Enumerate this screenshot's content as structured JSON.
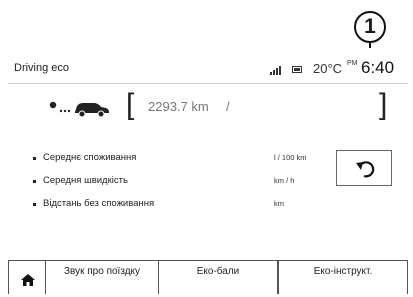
{
  "callout": {
    "number": "1"
  },
  "header": {
    "title": "Driving eco",
    "temperature": "20°C",
    "ampm": "PM",
    "time": "6:40"
  },
  "summary": {
    "car_icon": "trip-car-icon",
    "distance": "2293.7 km",
    "separator": "/"
  },
  "rows": [
    {
      "label": "Середнє споживання",
      "unit": "l / 100 km"
    },
    {
      "label": "Середня швидкість",
      "unit": "km / h"
    },
    {
      "label": "Відстань без споживання",
      "unit": "km"
    }
  ],
  "reset": {
    "icon": "reset-arrow-icon"
  },
  "tabs": [
    {
      "label": ""
    },
    {
      "label": "Звук про поїздку"
    },
    {
      "label": "Еко-бали"
    },
    {
      "label": "Еко-інструкт."
    }
  ]
}
